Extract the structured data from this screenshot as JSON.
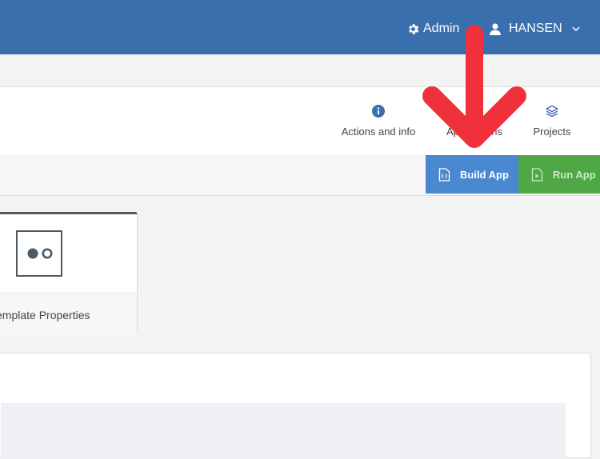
{
  "topbar": {
    "admin_icon": "gear-icon",
    "admin_label": "Admin",
    "user_icon": "user-icon",
    "user_name": "HANSEN",
    "user_menu_icon": "chevron-down-icon"
  },
  "nav": {
    "items": [
      {
        "label": "Actions and info",
        "icon": "info-icon"
      },
      {
        "label": "Applications",
        "icon": "grid-icon"
      },
      {
        "label": "Projects",
        "icon": "layers-icon"
      }
    ]
  },
  "toolbar": {
    "build_label": "Build App",
    "run_label": "Run App"
  },
  "card": {
    "label": "Template Properties",
    "icon": "toggle-circles-icon"
  },
  "colors": {
    "topbar": "#3a6fad",
    "build_button": "#4a88cf",
    "run_button": "#4fa845",
    "annotation_arrow": "#f0313b"
  },
  "annotation": {
    "icon": "red-arrow-down-icon"
  }
}
